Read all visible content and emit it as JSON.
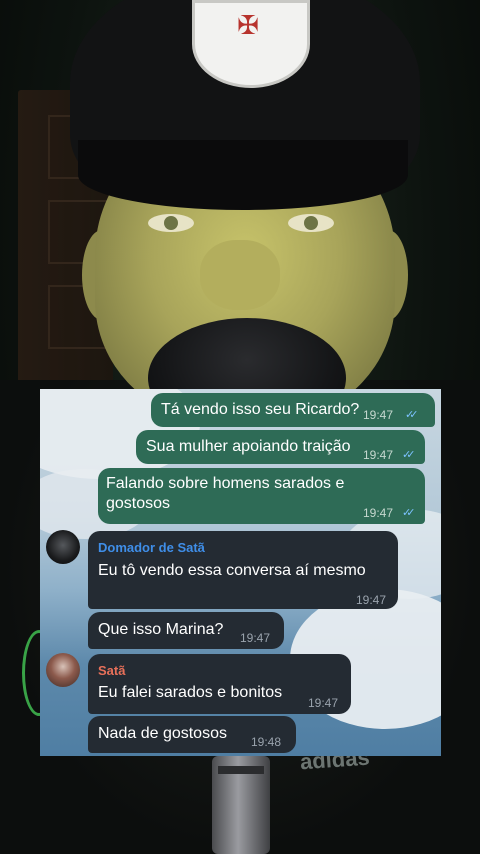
{
  "chat": {
    "messages": [
      {
        "direction": "outgoing",
        "text": "Tá vendo isso seu Ricardo?",
        "time": "19:47",
        "read": true
      },
      {
        "direction": "outgoing",
        "text": "Sua mulher apoiando traição",
        "time": "19:47",
        "read": true
      },
      {
        "direction": "outgoing",
        "text_line1": "Falando sobre homens sarados e",
        "text_line2": "gostosos",
        "time": "19:47",
        "read": true
      },
      {
        "direction": "incoming",
        "sender": "Domador de Satã",
        "text": "Eu tô vendo essa conversa aí mesmo",
        "time": "19:47"
      },
      {
        "direction": "incoming",
        "text": "Que isso Marina?",
        "time": "19:47"
      },
      {
        "direction": "incoming",
        "sender": "Satã",
        "text": "Eu falei sarados e bonitos",
        "time": "19:47"
      },
      {
        "direction": "incoming",
        "text": "Nada de gostosos",
        "time": "19:48"
      }
    ],
    "colors": {
      "outgoing_bubble": "#2e6b56",
      "incoming_bubble": "#242b33",
      "sender_1": "#3f8ee8",
      "sender_2": "#e8705a",
      "read_ticks": "#7cc2ff"
    }
  },
  "background": {
    "cap_logo": "club-shield",
    "shirt_brand_text": "adidas"
  }
}
